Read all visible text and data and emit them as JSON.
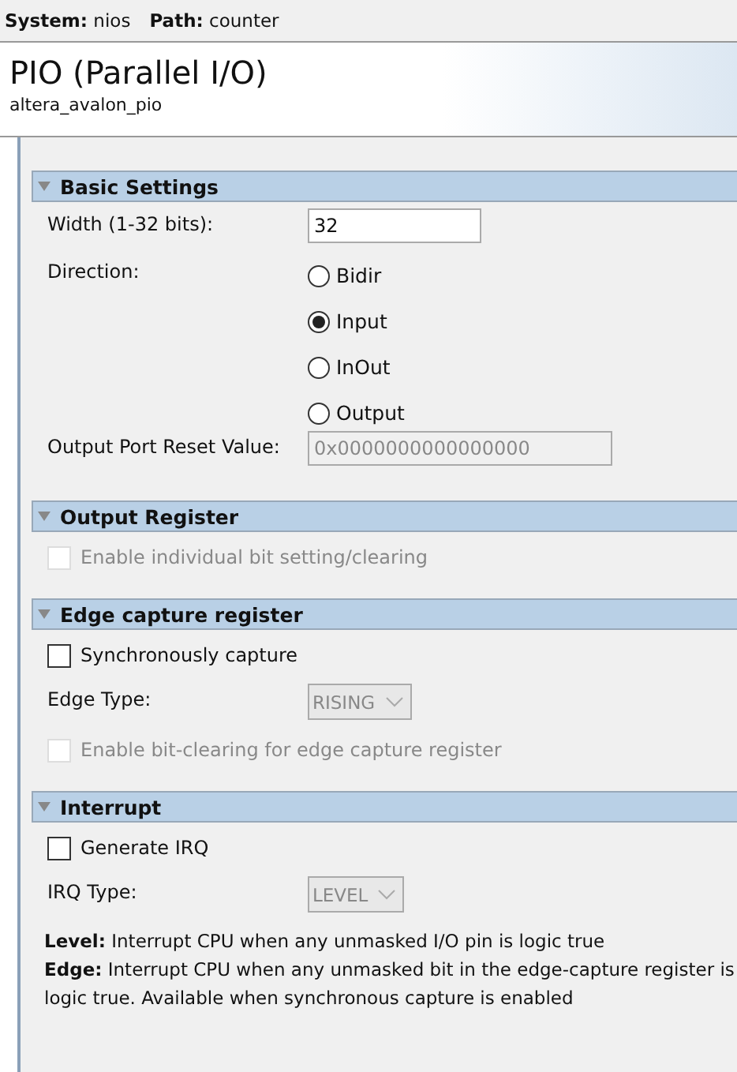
{
  "breadcrumb": [
    {
      "label": "System:",
      "value": "nios"
    },
    {
      "label": "Path:",
      "value": "counter"
    }
  ],
  "header": {
    "title": "PIO (Parallel I/O)",
    "subtitle": "altera_avalon_pio"
  },
  "sections": [
    {
      "title": "Basic Settings",
      "expanded": true,
      "items": [
        {
          "kind": "field",
          "label": "Width (1-32 bits):",
          "value": "32",
          "disabled": false
        },
        {
          "kind": "radio",
          "label": "Direction:",
          "options": [
            {
              "label": "Bidir",
              "selected": false
            },
            {
              "label": "Input",
              "selected": true
            },
            {
              "label": "InOut",
              "selected": false
            },
            {
              "label": "Output",
              "selected": false
            }
          ]
        },
        {
          "kind": "field",
          "label": "Output Port Reset Value:",
          "value": "0x0000000000000000",
          "disabled": true
        }
      ]
    },
    {
      "title": "Output Register",
      "expanded": true,
      "items": [
        {
          "kind": "checkbox",
          "label": "Enable individual bit setting/clearing",
          "checked": false,
          "disabled": true
        }
      ]
    },
    {
      "title": "Edge capture register",
      "expanded": true,
      "items": [
        {
          "kind": "checkbox",
          "label": "Synchronously capture",
          "checked": false,
          "disabled": false
        },
        {
          "kind": "dropdown",
          "label": "Edge Type:",
          "value": "RISING",
          "disabled": true
        },
        {
          "kind": "checkbox",
          "label": "Enable bit-clearing for edge capture register",
          "checked": false,
          "disabled": true
        }
      ]
    },
    {
      "title": "Interrupt",
      "expanded": true,
      "items": [
        {
          "kind": "checkbox",
          "label": "Generate IRQ",
          "checked": false,
          "disabled": false
        },
        {
          "kind": "dropdown",
          "label": "IRQ Type:",
          "value": "LEVEL",
          "disabled": true
        },
        {
          "kind": "note",
          "lines": [
            "**Level:** Interrupt CPU when any unmasked I/O pin is logic true",
            "**Edge:** Interrupt CPU when any unmasked bit in the edge-capture register is logic true. Available when synchronous capture is enabled"
          ]
        }
      ]
    }
  ]
}
